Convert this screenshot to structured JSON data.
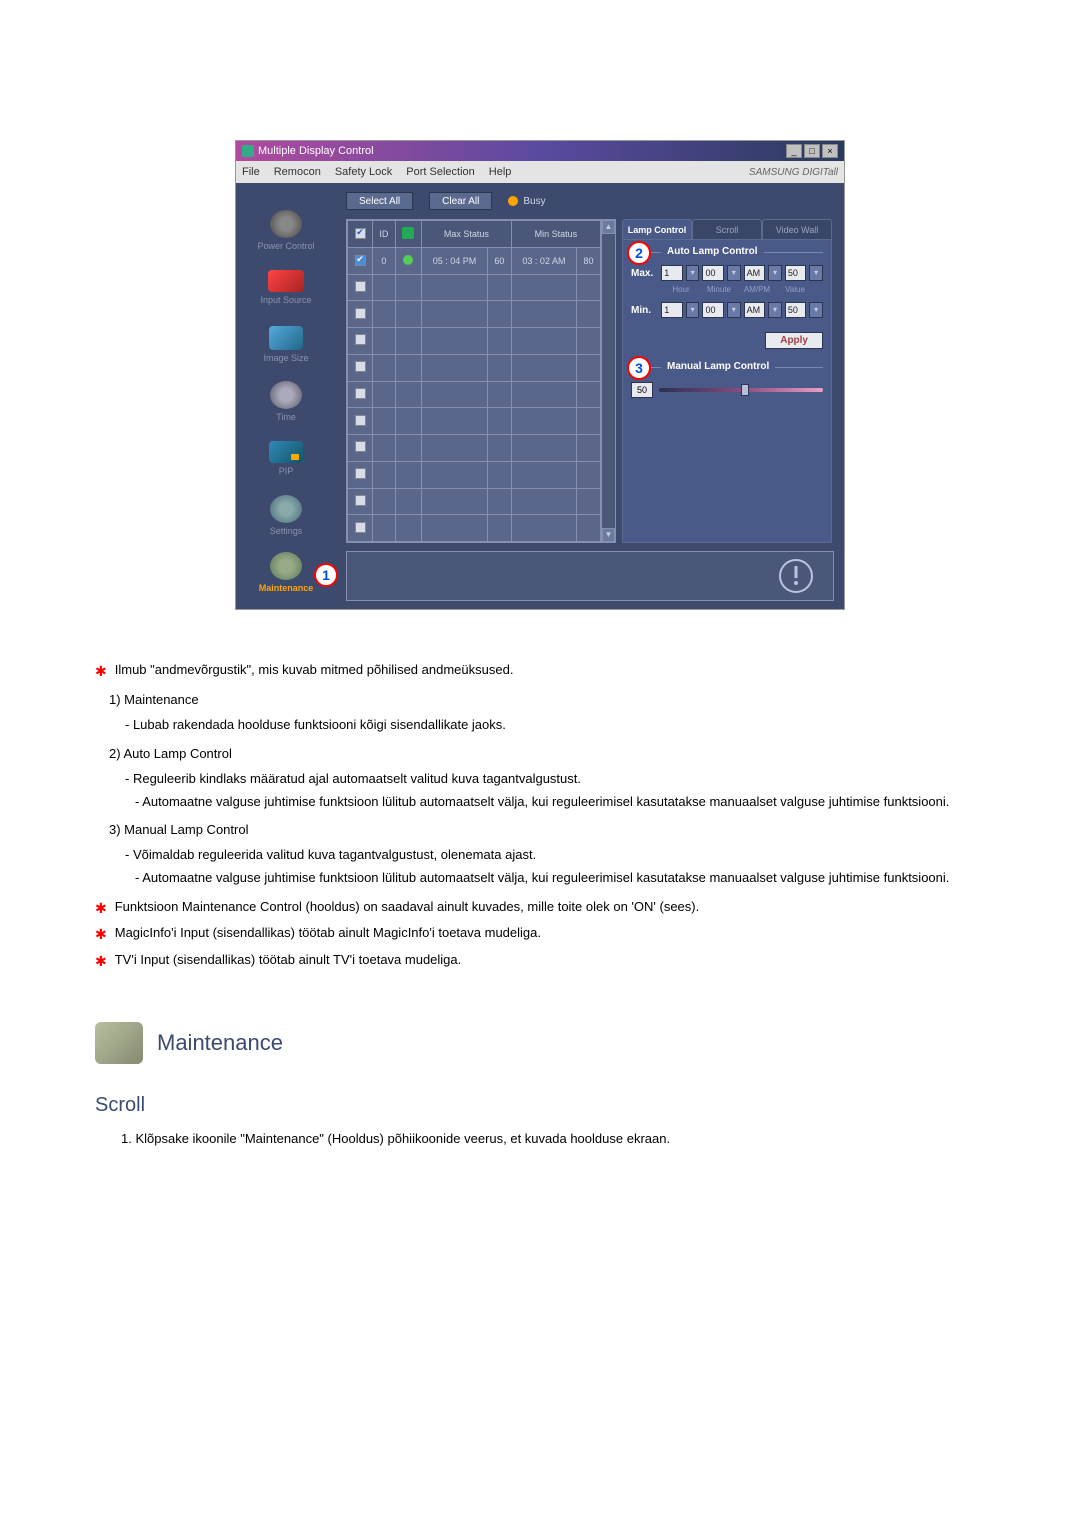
{
  "window": {
    "title": "Multiple Display Control",
    "brand": "SAMSUNG DIGITall"
  },
  "menu": {
    "file": "File",
    "remocon": "Remocon",
    "safety": "Safety Lock",
    "port": "Port Selection",
    "help": "Help"
  },
  "sidebar": {
    "power": "Power Control",
    "input": "Input Source",
    "imgsize": "Image Size",
    "time": "Time",
    "pip": "PIP",
    "settings": "Settings",
    "maintenance": "Maintenance"
  },
  "toolbar": {
    "select_all": "Select All",
    "clear_all": "Clear All",
    "busy": "Busy"
  },
  "table": {
    "headers": {
      "id": "ID",
      "max": "Max Status",
      "min": "Min Status"
    },
    "row0": {
      "id": "0",
      "max_time": "05 : 04 PM",
      "max_val": "60",
      "min_time": "03 : 02 AM",
      "min_val": "80"
    }
  },
  "tabs": {
    "lamp": "Lamp Control",
    "scroll": "Scroll",
    "video": "Video Wall"
  },
  "lamp": {
    "auto_title": "Auto Lamp Control",
    "manual_title": "Manual Lamp Control",
    "max": "Max.",
    "min": "Min.",
    "sub_hour": "Hour",
    "sub_minute": "Minute",
    "sub_ampm": "AM/PM",
    "sub_value": "Value",
    "hour1": "1",
    "minute1": "00",
    "ampm1": "AM",
    "value1": "50",
    "hour2": "1",
    "minute2": "00",
    "ampm2": "AM",
    "value2": "50",
    "apply": "Apply",
    "slider_val": "50"
  },
  "callouts": {
    "c1": "1",
    "c2": "2",
    "c3": "3"
  },
  "doc": {
    "star1": "Ilmub \"andmevõrgustik\", mis kuvab mitmed põhilised andmeüksused.",
    "n1": "1)  Maintenance",
    "n1s1": "Lubab rakendada hoolduse funktsiooni kõigi sisendallikate jaoks.",
    "n2": "2)  Auto Lamp Control",
    "n2s1": "Reguleerib kindlaks määratud ajal automaatselt valitud kuva tagantvalgustust.",
    "n2s2": "Automaatne valguse juhtimise funktsioon lülitub automaatselt välja, kui reguleerimisel kasutatakse manuaalset valguse juhtimise funktsiooni.",
    "n3": "3)  Manual Lamp Control",
    "n3s1": "Võimaldab reguleerida valitud kuva tagantvalgustust, olenemata ajast.",
    "n3s2": "Automaatne valguse juhtimise funktsioon lülitub automaatselt välja, kui reguleerimisel kasutatakse manuaalset valguse juhtimise funktsiooni.",
    "star2": "Funktsioon Maintenance Control (hooldus) on saadaval ainult kuvades, mille toite olek on 'ON' (sees).",
    "star3": "MagicInfo'i Input (sisendallikas) töötab ainult MagicInfo'i toetava mudeliga.",
    "star4": "TV'i Input (sisendallikas) töötab ainult TV'i toetava mudeliga.",
    "section_title": "Maintenance",
    "subsection_title": "Scroll",
    "ol1": "1.  Klõpsake ikoonile \"Maintenance\" (Hooldus) põhiikoonide veerus, et kuvada hoolduse ekraan."
  }
}
